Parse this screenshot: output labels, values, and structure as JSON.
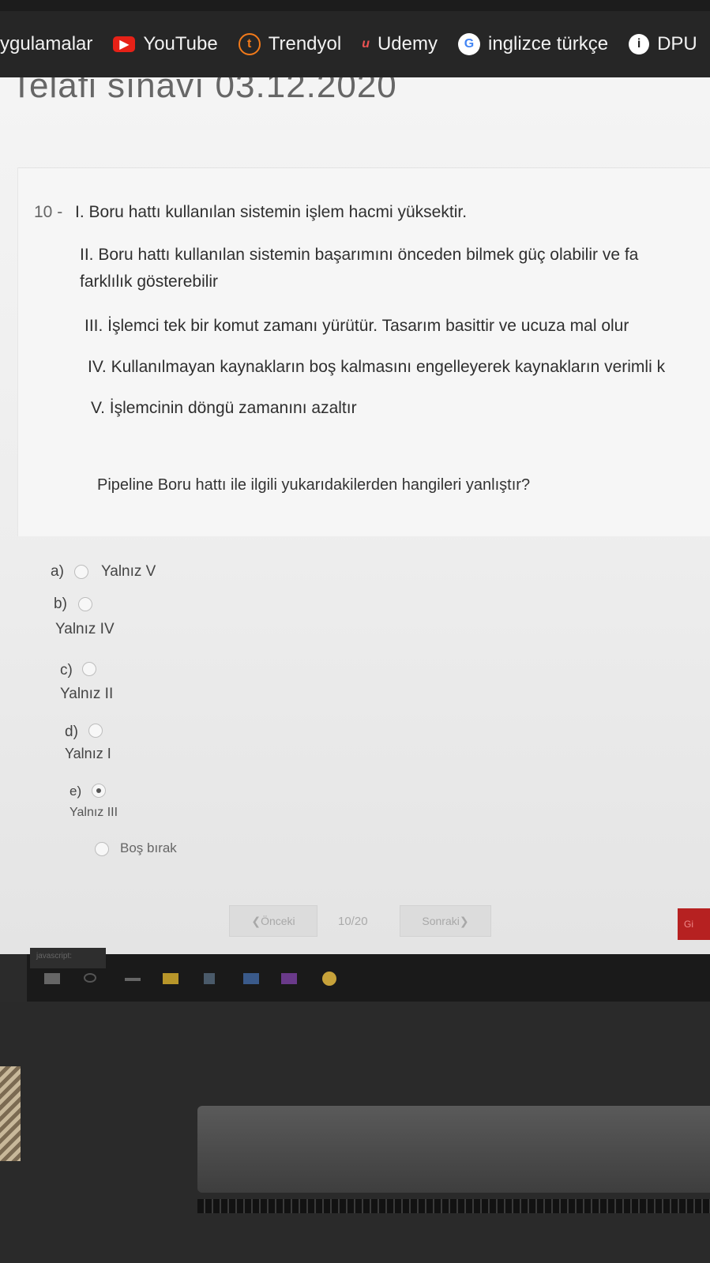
{
  "bookmarks": [
    {
      "label": "ygulamalar",
      "icon": ""
    },
    {
      "label": "YouTube",
      "icon": "youtube-icon"
    },
    {
      "label": "Trendyol",
      "icon": "trendyol-icon"
    },
    {
      "label": "Udemy",
      "icon": "udemy-icon"
    },
    {
      "label": "inglizce türkçe",
      "icon": "google-icon"
    },
    {
      "label": "DPU",
      "icon": "dpu-icon"
    }
  ],
  "exam": {
    "title": "Telafi sınavı 03.12.2020"
  },
  "question": {
    "number": "10 -",
    "statements": [
      "I. Boru hattı kullanılan sistemin işlem hacmi yüksektir.",
      "II. Boru hattı kullanılan sistemin başarımını önceden bilmek güç olabilir ve fa",
      "farklılık gösterebilir",
      "III. İşlemci tek bir komut zamanı yürütür. Tasarım basittir ve ucuza mal olur",
      "IV. Kullanılmayan kaynakların boş kalmasını engelleyerek kaynakların verimli k",
      "V. İşlemcinin döngü zamanını azaltır"
    ],
    "prompt": "Pipeline Boru hattı ile ilgili yukarıdakilerden hangileri yanlıştır?"
  },
  "options": [
    {
      "letter": "a)",
      "text": "Yalnız V",
      "selected": false
    },
    {
      "letter": "b)",
      "text": "Yalnız IV",
      "selected": false
    },
    {
      "letter": "c)",
      "text": "Yalnız II",
      "selected": false
    },
    {
      "letter": "d)",
      "text": "Yalnız I",
      "selected": false
    },
    {
      "letter": "e)",
      "text": "Yalnız III",
      "selected": true
    },
    {
      "letter": "",
      "text": "Boş bırak",
      "selected": false
    }
  ],
  "navigation": {
    "prev_label": "❮Önceki",
    "page_indicator": "10/20",
    "next_label": "Sonraki❯",
    "finish_label": "Gi"
  },
  "taskbar": {
    "js_label": "javascript:"
  }
}
